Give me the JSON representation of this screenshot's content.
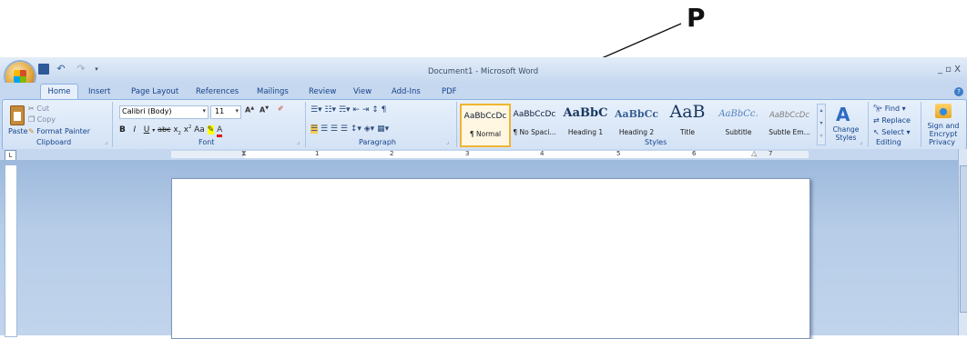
{
  "annotation": {
    "label": "P"
  },
  "title_bar": {
    "title": "Document1 - Microsoft Word",
    "window_controls": "_ ▫ X"
  },
  "tabs": [
    "Home",
    "Insert",
    "Page Layout",
    "References",
    "Mailings",
    "Review",
    "View",
    "Add-Ins",
    "PDF"
  ],
  "clipboard": {
    "paste": "Paste",
    "cut": "Cut",
    "copy": "Copy",
    "format_painter": "Format Painter",
    "label": "Clipboard"
  },
  "font": {
    "name": "Calibri (Body)",
    "size": "11",
    "label": "Font"
  },
  "paragraph": {
    "label": "Paragraph"
  },
  "styles": {
    "items": [
      {
        "preview": "AaBbCcDc",
        "name": "¶ Normal"
      },
      {
        "preview": "AaBbCcDc",
        "name": "¶ No Spaci..."
      },
      {
        "preview": "AaBbC",
        "name": "Heading 1"
      },
      {
        "preview": "AaBbCc",
        "name": "Heading 2"
      },
      {
        "preview": "AaB",
        "name": "Title"
      },
      {
        "preview": "AaBbCc.",
        "name": "Subtitle"
      },
      {
        "preview": "AaBbCcDc",
        "name": "Subtle Em..."
      }
    ],
    "change_styles": "Change Styles",
    "label": "Styles"
  },
  "editing": {
    "find": "Find",
    "replace": "Replace",
    "select": "Select",
    "label": "Editing"
  },
  "privacy": {
    "sign_encrypt": "Sign and Encrypt",
    "label": "Privacy"
  },
  "ruler": {
    "numbers": [
      "1",
      "2",
      "3",
      "4",
      "5",
      "6",
      "7"
    ]
  },
  "colors": {
    "ribbon": "#dbe8f8",
    "text": "#15428b",
    "workspace": "#a9c3e3",
    "page": "#ffffff"
  }
}
